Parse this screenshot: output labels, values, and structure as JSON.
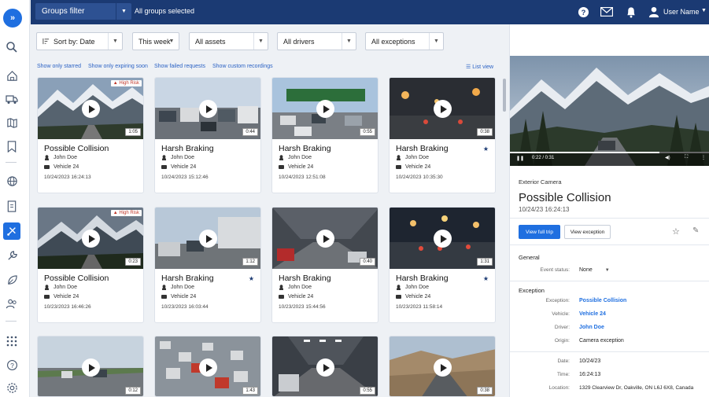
{
  "rail": {
    "toggle_glyph": "»",
    "icons": [
      "search-icon",
      "home-icon",
      "truck-icon",
      "map-icon",
      "bookmark-icon",
      "globe-icon",
      "report-icon",
      "event-icon",
      "wrench-icon",
      "leaf-icon",
      "people-icon",
      "apps-icon",
      "help-icon",
      "settings-icon"
    ],
    "active": "event-icon"
  },
  "topbar": {
    "groups_filter_label": "Groups filter",
    "groups_selected_text": "All groups selected",
    "user_name": "User Name",
    "icons": [
      "help-icon",
      "mail-icon",
      "bell-icon",
      "user-icon"
    ]
  },
  "filters": {
    "sort": "Sort by: Date",
    "period": "This week",
    "assets": "All assets",
    "drivers": "All drivers",
    "exceptions": "All exceptions"
  },
  "quick_links": {
    "starred": "Show only starred",
    "expiring": "Show only expiring soon",
    "failed": "Show failed requests",
    "custom": "Show custom recordings",
    "list_view": "List view"
  },
  "cards": [
    {
      "title": "Possible Collision",
      "driver": "John Doe",
      "vehicle": "Vehicle 24",
      "date": "10/24/2023 16:24:13",
      "duration": "1:05",
      "risk": "High Risk",
      "starred": false,
      "scene": "mountain"
    },
    {
      "title": "Harsh Braking",
      "driver": "John Doe",
      "vehicle": "Vehicle 24",
      "date": "10/24/2023 15:12:46",
      "duration": "0:44",
      "risk": "",
      "starred": false,
      "scene": "traffic"
    },
    {
      "title": "Harsh Braking",
      "driver": "John Doe",
      "vehicle": "Vehicle 24",
      "date": "10/24/2023 12:51:08",
      "duration": "0:55",
      "risk": "",
      "starred": false,
      "scene": "highway-sign"
    },
    {
      "title": "Harsh Braking",
      "driver": "John Doe",
      "vehicle": "Vehicle 24",
      "date": "10/24/2023 10:35:30",
      "duration": "0:38",
      "risk": "",
      "starred": true,
      "scene": "night"
    },
    {
      "title": "Possible Collision",
      "driver": "John Doe",
      "vehicle": "Vehicle 24",
      "date": "10/23/2023 16:46:26",
      "duration": "0:23",
      "risk": "High Risk",
      "starred": false,
      "scene": "mountain-dark"
    },
    {
      "title": "Harsh Braking",
      "driver": "John Doe",
      "vehicle": "Vehicle 24",
      "date": "10/23/2023 16:03:44",
      "duration": "1:12",
      "risk": "",
      "starred": true,
      "scene": "truck"
    },
    {
      "title": "Harsh Braking",
      "driver": "John Doe",
      "vehicle": "Vehicle 24",
      "date": "10/23/2023 15:44:56",
      "duration": "0:40",
      "risk": "",
      "starred": false,
      "scene": "tunnel"
    },
    {
      "title": "Harsh Braking",
      "driver": "John Doe",
      "vehicle": "Vehicle 24",
      "date": "10/23/2023 11:58:14",
      "duration": "1:31",
      "risk": "",
      "starred": true,
      "scene": "city-night"
    },
    {
      "title": "",
      "driver": "",
      "vehicle": "",
      "date": "",
      "duration": "0:12",
      "risk": "",
      "starred": false,
      "scene": "freeway"
    },
    {
      "title": "",
      "driver": "",
      "vehicle": "",
      "date": "",
      "duration": "1:43",
      "risk": "",
      "starred": false,
      "scene": "jam"
    },
    {
      "title": "",
      "driver": "",
      "vehicle": "",
      "date": "",
      "duration": "0:55",
      "risk": "",
      "starred": false,
      "scene": "tunnel2"
    },
    {
      "title": "",
      "driver": "",
      "vehicle": "",
      "date": "",
      "duration": "0:38",
      "risk": "",
      "starred": false,
      "scene": "desert"
    }
  ],
  "detail": {
    "video_time": "0:22 / 0:31",
    "camera": "Exterior Camera",
    "title": "Possible Collision",
    "timestamp": "10/24/23 16:24:13",
    "view_full_trip": "View full trip",
    "view_exception": "View exception",
    "general_heading": "General",
    "event_status_label": "Event status:",
    "event_status_value": "None",
    "exception_heading": "Exception",
    "rows": [
      {
        "label": "Exception:",
        "value": "Possible Collision",
        "link": true
      },
      {
        "label": "Vehicle:",
        "value": "Vehicle 24",
        "link": true
      },
      {
        "label": "Driver:",
        "value": "John Doe",
        "link": true
      },
      {
        "label": "Origin:",
        "value": "Camera exception",
        "link": false
      },
      {
        "label": "Date:",
        "value": "10/24/23",
        "link": false
      },
      {
        "label": "Time:",
        "value": "16:24:13",
        "link": false
      },
      {
        "label": "Location:",
        "value": "1329 Clearview Dr, Oakville, ON L6J 6X8, Canada",
        "link": false
      }
    ]
  },
  "colors": {
    "brand": "#1b3a73",
    "accent": "#1f6fe0",
    "risk": "#c0392b"
  }
}
